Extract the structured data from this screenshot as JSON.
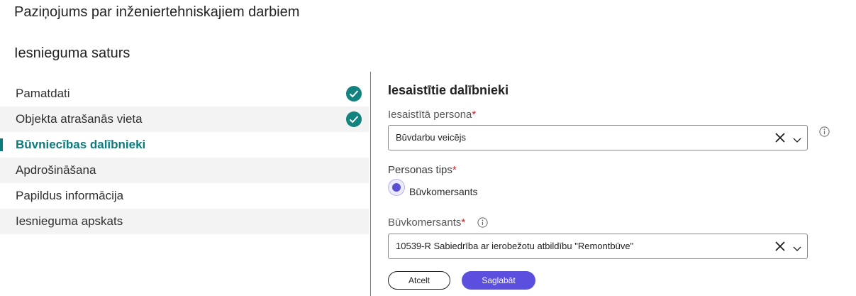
{
  "header": {
    "title": "Paziņojums par inženiertehniskajiem darbiem",
    "section_title": "Iesnieguma saturs"
  },
  "sidebar": {
    "items": [
      {
        "label": "Pamatdati",
        "completed": true
      },
      {
        "label": "Objekta atrašanās vieta",
        "completed": true
      },
      {
        "label": "Būvniecības dalībnieki",
        "active": true
      },
      {
        "label": "Apdrošināšana"
      },
      {
        "label": "Papildus informācija"
      },
      {
        "label": "Iesnieguma apskats"
      }
    ]
  },
  "form": {
    "heading": "Iesaistītie dalībnieki",
    "person": {
      "label": "Iesaistītā persona",
      "required_mark": "*",
      "value": "Būvdarbu veicējs"
    },
    "person_type": {
      "label": "Personas tips",
      "required_mark": "*",
      "option": "Būvkomersants",
      "selected": true
    },
    "builder": {
      "label": "Būvkomersants",
      "required_mark": "*",
      "value": "10539-R Sabiedrība ar ierobežotu atbildību \"Remontbūve\""
    },
    "buttons": {
      "cancel": "Atcelt",
      "save": "Saglabāt"
    }
  },
  "colors": {
    "accent_teal": "#0b7b7c",
    "check_green": "#13837f",
    "primary_button": "#5b4fe0",
    "required": "#c4262e"
  },
  "icons": {
    "check": "check-circle-icon",
    "clear": "close-icon",
    "dropdown": "chevron-down-icon",
    "info": "info-icon"
  }
}
